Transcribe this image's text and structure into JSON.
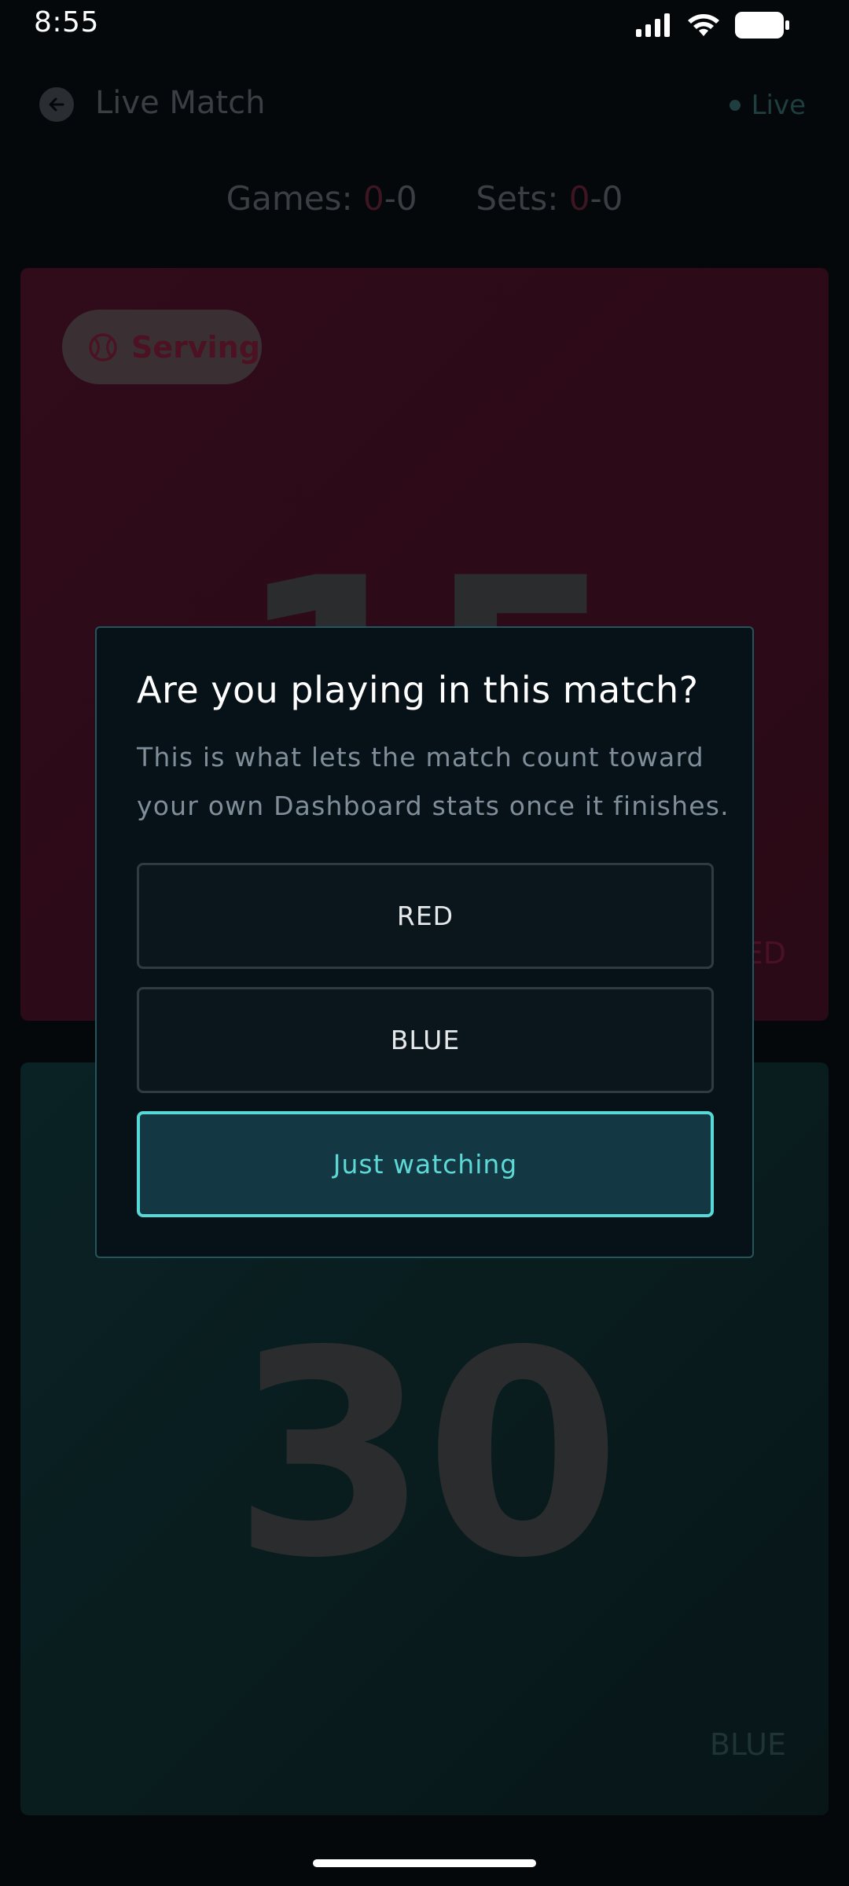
{
  "status_bar": {
    "time": "8:55"
  },
  "header": {
    "title": "Live Match",
    "live_label": "Live"
  },
  "scoreline": {
    "games_label": "Games:",
    "games_red": "0",
    "games_blue": "-0",
    "sets_label": "Sets:",
    "sets_red": "0",
    "sets_blue": "-0"
  },
  "red_team": {
    "serving_label": "Serving",
    "score": "15",
    "tag": "RED"
  },
  "blue_team": {
    "score": "30",
    "tag": "BLUE"
  },
  "dialog": {
    "title": "Are you playing in this match?",
    "body": "This is what lets the match count toward your own Dashboard stats once it finishes.",
    "option_red": "RED",
    "option_blue": "BLUE",
    "option_watch": "Just watching"
  },
  "colors": {
    "accent": "#57d9d8",
    "red_team": "#300b1a",
    "blue_team": "#0a2224"
  },
  "icons": {
    "back": "arrow-left-icon",
    "serving": "tennis-ball-icon",
    "signal": "signal-icon",
    "wifi": "wifi-icon",
    "battery": "battery-icon"
  }
}
